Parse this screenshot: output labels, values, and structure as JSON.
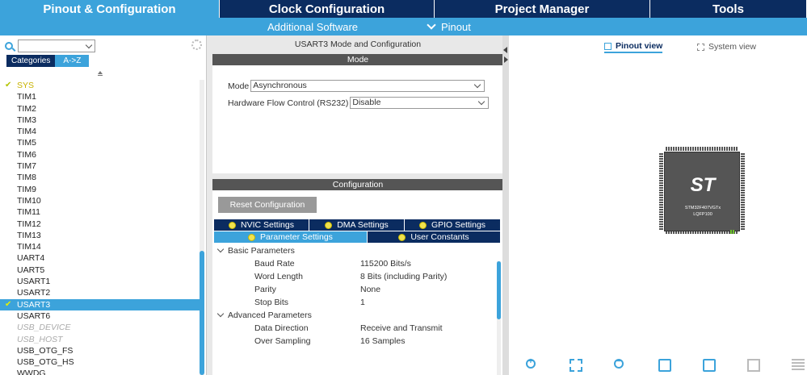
{
  "topnav": {
    "pinout": "Pinout & Configuration",
    "clock": "Clock Configuration",
    "project_manager": "Project Manager",
    "tools": "Tools"
  },
  "subnav": {
    "additional_software": "Additional Software",
    "pinout": "Pinout"
  },
  "left": {
    "search_value": "",
    "tabs": [
      "Categories",
      "A->Z"
    ],
    "peripherals": [
      {
        "label": "SYS",
        "state": "ok"
      },
      {
        "label": "TIM1",
        "state": "normal"
      },
      {
        "label": "TIM2",
        "state": "normal"
      },
      {
        "label": "TIM3",
        "state": "normal"
      },
      {
        "label": "TIM4",
        "state": "normal"
      },
      {
        "label": "TIM5",
        "state": "normal"
      },
      {
        "label": "TIM6",
        "state": "normal"
      },
      {
        "label": "TIM7",
        "state": "normal"
      },
      {
        "label": "TIM8",
        "state": "normal"
      },
      {
        "label": "TIM9",
        "state": "normal"
      },
      {
        "label": "TIM10",
        "state": "normal"
      },
      {
        "label": "TIM11",
        "state": "normal"
      },
      {
        "label": "TIM12",
        "state": "normal"
      },
      {
        "label": "TIM13",
        "state": "normal"
      },
      {
        "label": "TIM14",
        "state": "normal"
      },
      {
        "label": "UART4",
        "state": "normal"
      },
      {
        "label": "UART5",
        "state": "normal"
      },
      {
        "label": "USART1",
        "state": "normal"
      },
      {
        "label": "USART2",
        "state": "normal"
      },
      {
        "label": "USART3",
        "state": "selected"
      },
      {
        "label": "USART6",
        "state": "normal"
      },
      {
        "label": "USB_DEVICE",
        "state": "disabled"
      },
      {
        "label": "USB_HOST",
        "state": "disabled"
      },
      {
        "label": "USB_OTG_FS",
        "state": "normal"
      },
      {
        "label": "USB_OTG_HS",
        "state": "normal"
      },
      {
        "label": "WWDG",
        "state": "normal"
      }
    ]
  },
  "mid": {
    "title": "USART3 Mode and Configuration",
    "mode_header": "Mode",
    "mode_label": "Mode",
    "mode_value": "Asynchronous",
    "hw_flow_label": "Hardware Flow Control (RS232)",
    "hw_flow_value": "Disable",
    "config_header": "Configuration",
    "reset_button": "Reset Configuration",
    "tabs": {
      "nvic": "NVIC Settings",
      "dma": "DMA Settings",
      "gpio": "GPIO Settings",
      "params": "Parameter Settings",
      "user_constants": "User Constants"
    },
    "basic_group": "Basic Parameters",
    "basic": [
      {
        "k": "Baud Rate",
        "v": "115200 Bits/s"
      },
      {
        "k": "Word Length",
        "v": "8 Bits (including Parity)"
      },
      {
        "k": "Parity",
        "v": "None"
      },
      {
        "k": "Stop Bits",
        "v": "1"
      }
    ],
    "advanced_group": "Advanced Parameters",
    "advanced": [
      {
        "k": "Data Direction",
        "v": "Receive and Transmit"
      },
      {
        "k": "Over Sampling",
        "v": "16 Samples"
      }
    ]
  },
  "right": {
    "pinout_view": "Pinout view",
    "system_view": "System view",
    "chip_logo": "ST",
    "chip_name": "STM32F407VGTx",
    "chip_package": "LQFP100"
  },
  "colors": {
    "accent": "#3ca3db",
    "dark": "#0b2c60",
    "ok": "#c8b200"
  }
}
